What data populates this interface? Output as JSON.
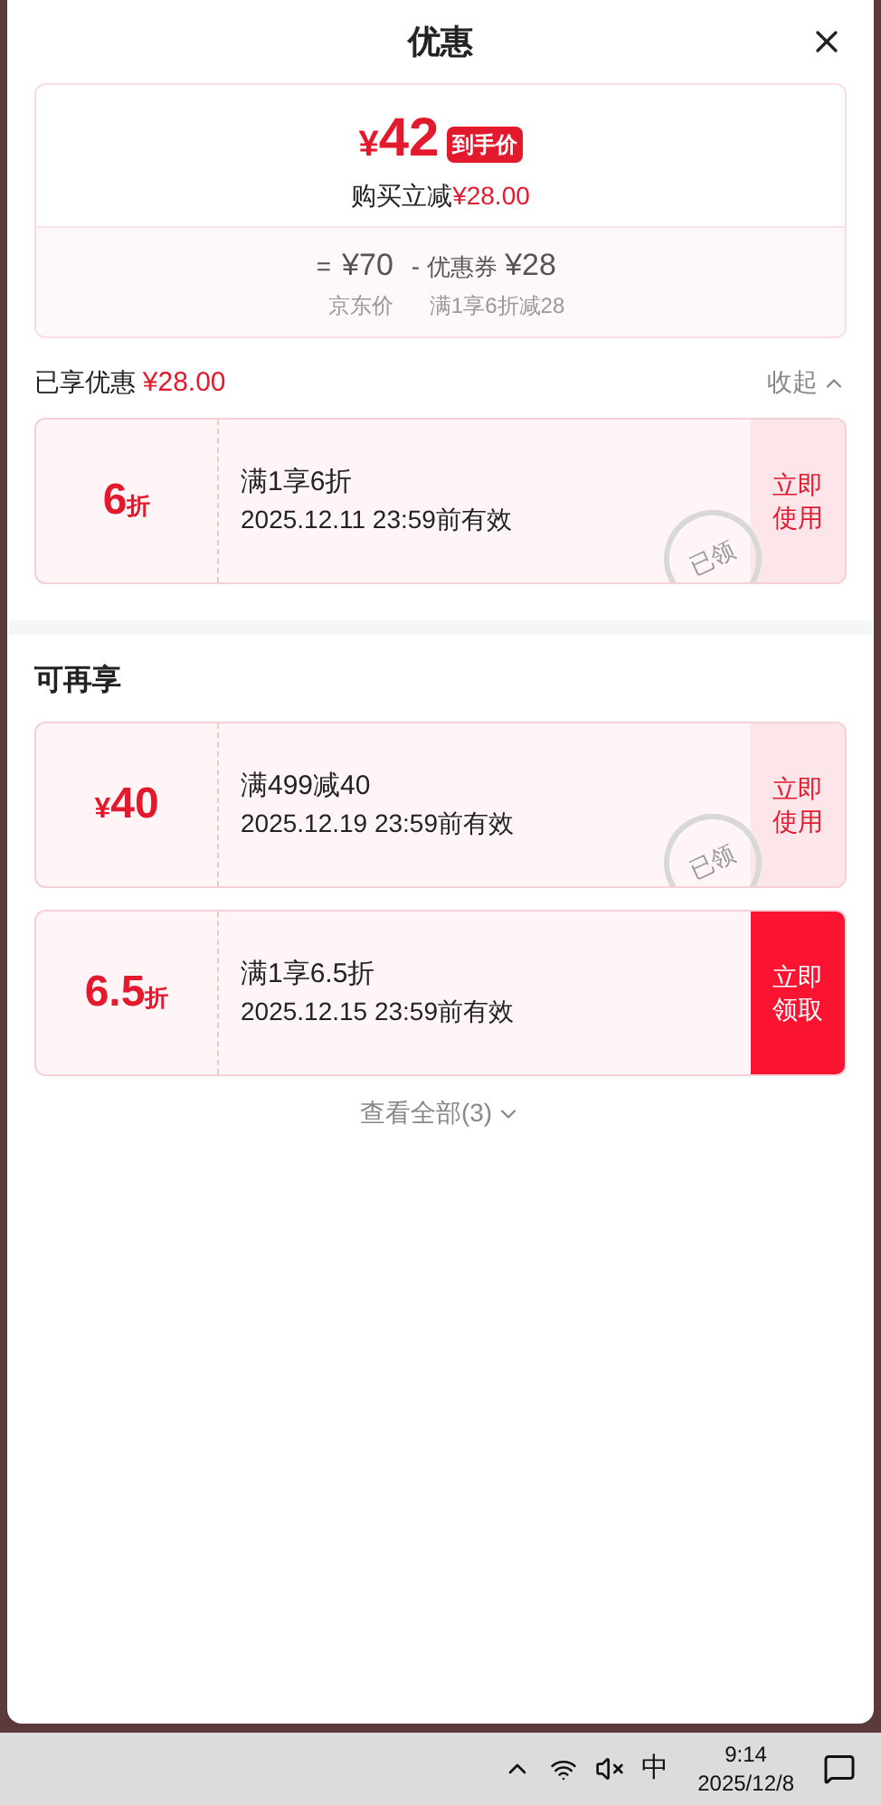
{
  "header": {
    "title": "优惠"
  },
  "summary": {
    "currency": "¥",
    "final_price": "42",
    "final_tag": "到手价",
    "saving_label": "购买立减",
    "saving_amount": "¥28.00",
    "equals": "=",
    "base_price": "¥70",
    "minus": "-",
    "coupon_label": "优惠券",
    "coupon_amount": "¥28",
    "base_caption": "京东价",
    "coupon_caption": "满1享6折减28"
  },
  "enjoyed": {
    "label": "已享优惠",
    "amount": "¥28.00",
    "toggle": "收起"
  },
  "enjoyed_coupons": [
    {
      "amount": "6",
      "suffix": "折",
      "title": "满1享6折",
      "validity": "2025.12.11 23:59前有效",
      "claimed": true,
      "stamp": "已领",
      "action": [
        "立即",
        "使用"
      ]
    }
  ],
  "more": {
    "title": "可再享"
  },
  "more_coupons": [
    {
      "prefix": "¥",
      "amount": "40",
      "title": "满499减40",
      "validity": "2025.12.19 23:59前有效",
      "claimed": true,
      "stamp": "已领",
      "action": [
        "立即",
        "使用"
      ]
    },
    {
      "amount": "6.5",
      "suffix": "折",
      "title": "满1享6.5折",
      "validity": "2025.12.15 23:59前有效",
      "claimed": false,
      "action": [
        "立即",
        "领取"
      ]
    }
  ],
  "view_all": "查看全部(3)",
  "taskbar": {
    "ime": "中",
    "time": "9:14",
    "date": "2025/12/8"
  }
}
